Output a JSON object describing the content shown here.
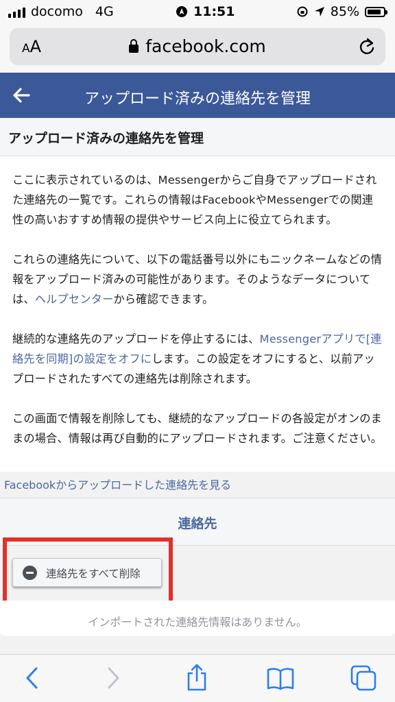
{
  "status_bar": {
    "carrier": "docomo",
    "network": "4G",
    "time": "11:51",
    "battery": "85%",
    "battery_level": 0.85
  },
  "browser": {
    "text_size_label": "AA",
    "url": "facebook.com"
  },
  "header": {
    "title": "アップロード済みの連絡先を管理"
  },
  "card": {
    "title": "アップロード済みの連絡先を管理",
    "para1": "ここに表示されているのは、Messengerからご自身でアップロードされた連絡先の一覧です。これらの情報はFacebookやMessengerでの関連性の高いおすすめ情報の提供やサービス向上に役立てられます。",
    "para2_before": "これらの連絡先について、以下の電話番号以外にもニックネームなどの情報をアップロード済みの可能性があります。そのようなデータについては、",
    "para2_link": "ヘルプセンター",
    "para2_after": "から確認できます。",
    "para3_before": "継続的な連絡先のアップロードを停止するには、",
    "para3_link": "Messengerアプリで[連絡先を同期]の設定をオフに",
    "para3_after": "します。この設定をオフにすると、以前アップロードされたすべての連絡先は削除されます。",
    "para4": "この画面で情報を削除しても、継続的なアップロードの各設定がオンのままの場合、情報は再び自動的にアップロードされます。ご注意ください。"
  },
  "view_link": "Facebookからアップロードした連絡先を見る",
  "contacts_tab": "連絡先",
  "delete_button": "連絡先をすべて削除",
  "empty_message": "インポートされた連絡先情報はありません。",
  "colors": {
    "fb_blue": "#3b5998",
    "link": "#4b67a1",
    "highlight": "#e0322b",
    "safari_blue": "#2b7cf6"
  }
}
